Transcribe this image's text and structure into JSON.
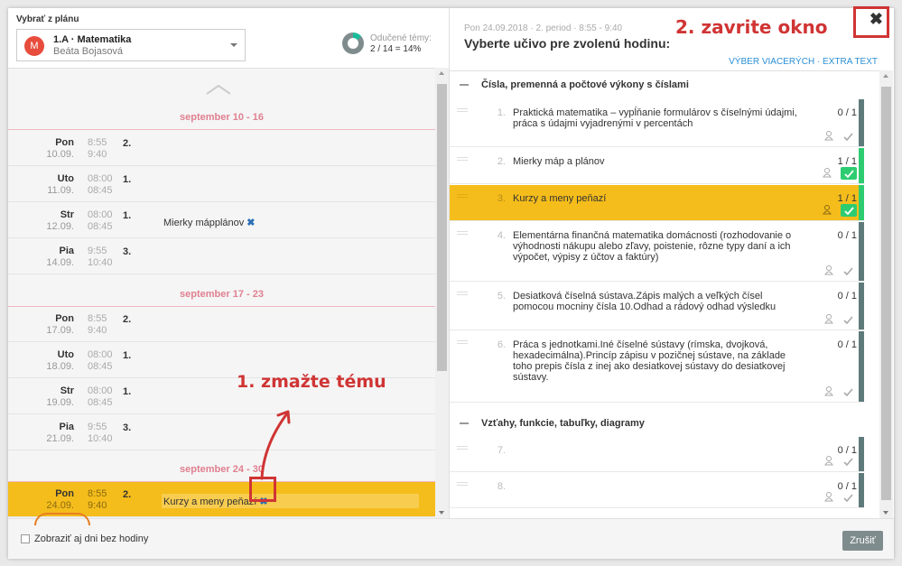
{
  "left": {
    "select_label": "Vybrať z plánu",
    "plan": {
      "avatar": "M",
      "title": "1.A · Matematika",
      "teacher": "Beáta Bojasová"
    },
    "topics_label": "Odučené témy:",
    "topics_value": "2 / 14 = 14%",
    "weeks": [
      {
        "label": "september 10 - 16",
        "days": [
          {
            "name": "Pon",
            "date": "10.09.",
            "t1": "8:55",
            "t2": "9:40",
            "period": "2.",
            "topic": ""
          },
          {
            "name": "Uto",
            "date": "11.09.",
            "t1": "08:00",
            "t2": "08:45",
            "period": "1.",
            "topic": ""
          },
          {
            "name": "Str",
            "date": "12.09.",
            "t1": "08:00",
            "t2": "08:45",
            "period": "1.",
            "topic": "Mierky mápplánov"
          },
          {
            "name": "Pia",
            "date": "14.09.",
            "t1": "9:55",
            "t2": "10:40",
            "period": "3.",
            "topic": ""
          }
        ]
      },
      {
        "label": "september 17 - 23",
        "days": [
          {
            "name": "Pon",
            "date": "17.09.",
            "t1": "8:55",
            "t2": "9:40",
            "period": "2.",
            "topic": ""
          },
          {
            "name": "Uto",
            "date": "18.09.",
            "t1": "08:00",
            "t2": "08:45",
            "period": "1.",
            "topic": ""
          },
          {
            "name": "Str",
            "date": "19.09.",
            "t1": "08:00",
            "t2": "08:45",
            "period": "1.",
            "topic": ""
          },
          {
            "name": "Pia",
            "date": "21.09.",
            "t1": "9:55",
            "t2": "10:40",
            "period": "3.",
            "topic": ""
          }
        ]
      },
      {
        "label": "september 24 - 30",
        "days": [
          {
            "name": "Pon",
            "date": "24.09.",
            "t1": "8:55",
            "t2": "9:40",
            "period": "2.",
            "topic": "Kurzy a meny peňazí"
          }
        ]
      }
    ],
    "footer_checkbox": "Zobraziť aj dni bez hodiny"
  },
  "right": {
    "meta": "Pon 24.09.2018 · 2. period · 8:55 - 9:40",
    "title": "Vyberte učivo pre zvolenú hodinu:",
    "links": "VÝBER VIACERÝCH · EXTRA TEXT",
    "close": "✖",
    "sections": [
      {
        "title": "Čísla, premenná a počtové výkony s číslami",
        "items": [
          {
            "num": "1.",
            "text": "Praktická matematika – vypĺňanie formulárov s číselnými údajmi, práca s údajmi vyjadrenými v percentách",
            "count": "0 / 1"
          },
          {
            "num": "2.",
            "text": "Mierky máp a plánov",
            "count": "1 / 1"
          },
          {
            "num": "3.",
            "text": "Kurzy a meny peňazí",
            "count": "1 / 1"
          },
          {
            "num": "4.",
            "text": "Elementárna finančná matematika domácnosti (rozhodovanie o výhodnosti nákupu alebo zľavy, poistenie, rôzne typy daní a ich výpočet, výpisy z účtov a faktúry)",
            "count": "0 / 1"
          },
          {
            "num": "5.",
            "text": "Desiatková číselná sústava.Zápis malých a veľkých čísel pomocou mocniny čísla 10.Odhad a rádový odhad výsledku",
            "count": "0 / 1"
          },
          {
            "num": "6.",
            "text": "Práca s jednotkami.Iné číselné sústavy (rímska, dvojková, hexadecimálna).Princíp zápisu v pozičnej sústave, na základe toho prepis čísla z inej ako desiatkovej sústavy do desiatkovej sústavy.",
            "count": "0 / 1"
          }
        ]
      },
      {
        "title": "Vzťahy, funkcie, tabuľky, diagramy",
        "items": [
          {
            "num": "7.",
            "text": "",
            "count": "0 / 1"
          },
          {
            "num": "8.",
            "text": "",
            "count": "0 / 1"
          }
        ]
      }
    ],
    "cancel": "Zrušiť"
  },
  "annotations": {
    "step1": "1. zmažte tému",
    "step2": "2. zavrite okno"
  },
  "colors": {
    "selected": "#f5bd1b",
    "accent_blue": "#2a8fd6",
    "green": "#2ecc71",
    "annotation_red": "#d03434",
    "week_pink": "#e08090"
  }
}
